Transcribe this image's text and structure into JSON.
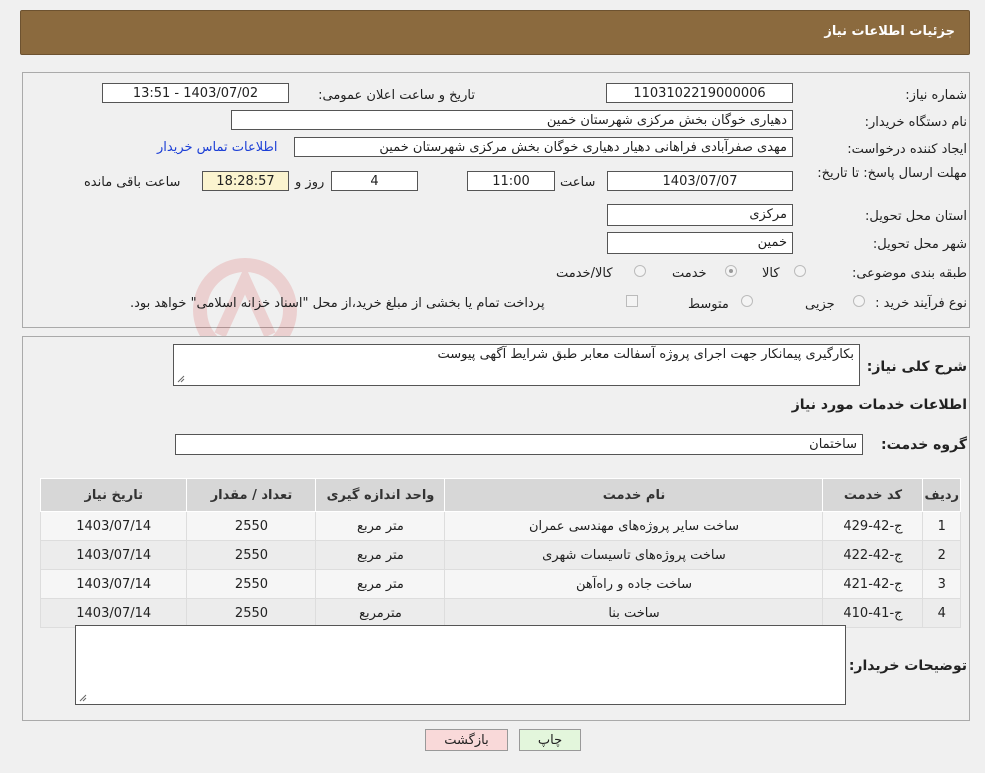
{
  "header": {
    "title": "جزئیات اطلاعات نیاز"
  },
  "form": {
    "need_number_label": "شماره نیاز:",
    "need_number": "1103102219000006",
    "announce_label": "تاریخ و ساعت اعلان عمومی:",
    "announce_value": "1403/07/02 - 13:51",
    "buyer_label": "نام دستگاه خریدار:",
    "buyer_value": "دهیاری خوگان بخش مرکزی شهرستان خمین",
    "creator_label": "ایجاد کننده درخواست:",
    "creator_value": "مهدی صفرآبادی فراهانی دهیار دهیاری خوگان بخش مرکزی شهرستان خمین",
    "contact_link": "اطلاعات تماس خریدار",
    "deadline_label": "مهلت ارسال پاسخ: تا تاریخ:",
    "deadline_date": "1403/07/07",
    "time_label": "ساعت",
    "deadline_time": "11:00",
    "days_value": "4",
    "days_label": "روز و",
    "remaining_time": "18:28:57",
    "remaining_label": "ساعت باقی مانده",
    "province_label": "استان محل تحویل:",
    "province_value": "مرکزی",
    "city_label": "شهر محل تحویل:",
    "city_value": "خمین",
    "category_label": "طبقه بندی موضوعی:",
    "category_options": [
      "کالا",
      "خدمت",
      "کالا/خدمت"
    ],
    "category_selected": "خدمت",
    "process_label": "نوع فرآیند خرید :",
    "process_options": [
      "جزیی",
      "متوسط"
    ],
    "process_note": "پرداخت تمام یا بخشی از مبلغ خرید،از محل \"اسناد خزانه اسلامی\" خواهد بود."
  },
  "description": {
    "label": "شرح کلی نیاز:",
    "value": "بکارگیری پیمانکار جهت اجرای پروژه آسفالت معابر طبق شرایط آگهی پیوست"
  },
  "services": {
    "section_title": "اطلاعات خدمات مورد نیاز",
    "group_label": "گروه خدمت:",
    "group_value": "ساختمان",
    "columns": [
      "ردیف",
      "کد خدمت",
      "نام خدمت",
      "واحد اندازه گیری",
      "تعداد / مقدار",
      "تاریخ نیاز"
    ],
    "rows": [
      [
        "1",
        "ج-42-429",
        "ساخت سایر پروژه‌های مهندسی عمران",
        "متر مربع",
        "2550",
        "1403/07/14"
      ],
      [
        "2",
        "ج-42-422",
        "ساخت پروژه‌های تاسیسات شهری",
        "متر مربع",
        "2550",
        "1403/07/14"
      ],
      [
        "3",
        "ج-42-421",
        "ساخت جاده و راه‌آهن",
        "متر مربع",
        "2550",
        "1403/07/14"
      ],
      [
        "4",
        "ج-41-410",
        "ساخت بنا",
        "مترمربع",
        "2550",
        "1403/07/14"
      ]
    ]
  },
  "buyer_notes": {
    "label": "توضیحات خریدار:",
    "value": ""
  },
  "buttons": {
    "print": "چاپ",
    "back": "بازگشت"
  },
  "colors": {
    "header_bg": "#8b6a3e",
    "link": "#1c3fd6",
    "back_btn": "#f9d9d9",
    "print_btn": "#e3f6dc"
  }
}
